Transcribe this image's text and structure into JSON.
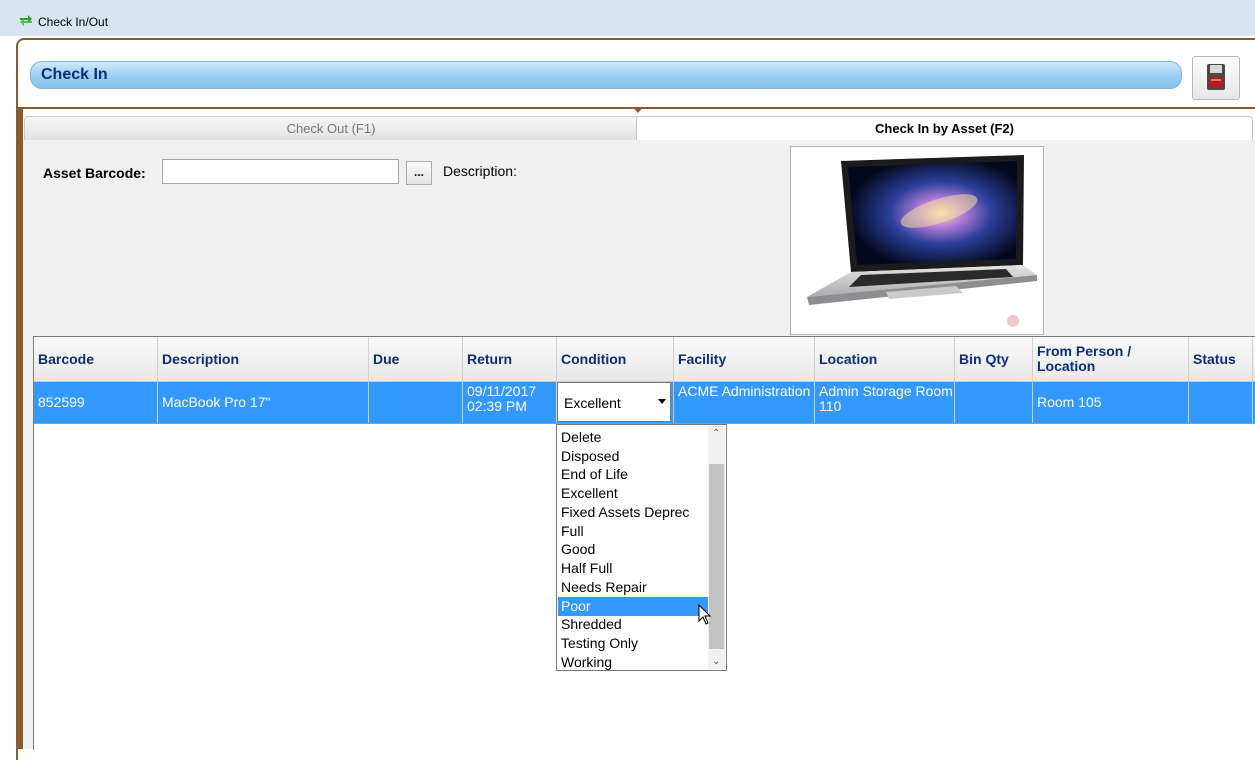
{
  "window": {
    "title": "Check In/Out"
  },
  "section_header": {
    "label": "Check In"
  },
  "tabs": [
    {
      "label": "Check Out (F1)",
      "active": false
    },
    {
      "label": "Check In by Asset (F2)",
      "active": true
    }
  ],
  "asset_form": {
    "barcode_label": "Asset Barcode:",
    "barcode_value": "",
    "browse_button": "...",
    "description_label": "Description:"
  },
  "grid": {
    "columns": [
      "Barcode",
      "Description",
      "Due",
      "Return",
      "Condition",
      "Facility",
      "Location",
      "Bin Qty",
      "From Person / Location",
      "Status"
    ],
    "row": {
      "barcode": "852599",
      "description": "MacBook Pro 17\"",
      "due": "",
      "return": "09/11/2017 02:39 PM",
      "condition": "Excellent",
      "facility": "ACME Administration",
      "location": "Admin Storage Room 110",
      "bin_qty": "",
      "from_person_location": "Room 105",
      "status": ""
    }
  },
  "condition_dropdown": {
    "options": [
      "Delete",
      "Disposed",
      "End of Life",
      "Excellent",
      "Fixed Assets Deprec",
      "Full",
      "Good",
      "Half Full",
      "Needs Repair",
      "Poor",
      "Shredded",
      "Testing Only",
      "Working"
    ],
    "highlighted": "Poor"
  },
  "colors": {
    "selection": "#3399ff",
    "frame_brown": "#8b5a2b",
    "header_text": "#0c2d7a"
  },
  "icons": {
    "app": "check-in-out-arrows-icon",
    "save": "floppy-disk-icon",
    "asset_photo": "laptop-image"
  }
}
